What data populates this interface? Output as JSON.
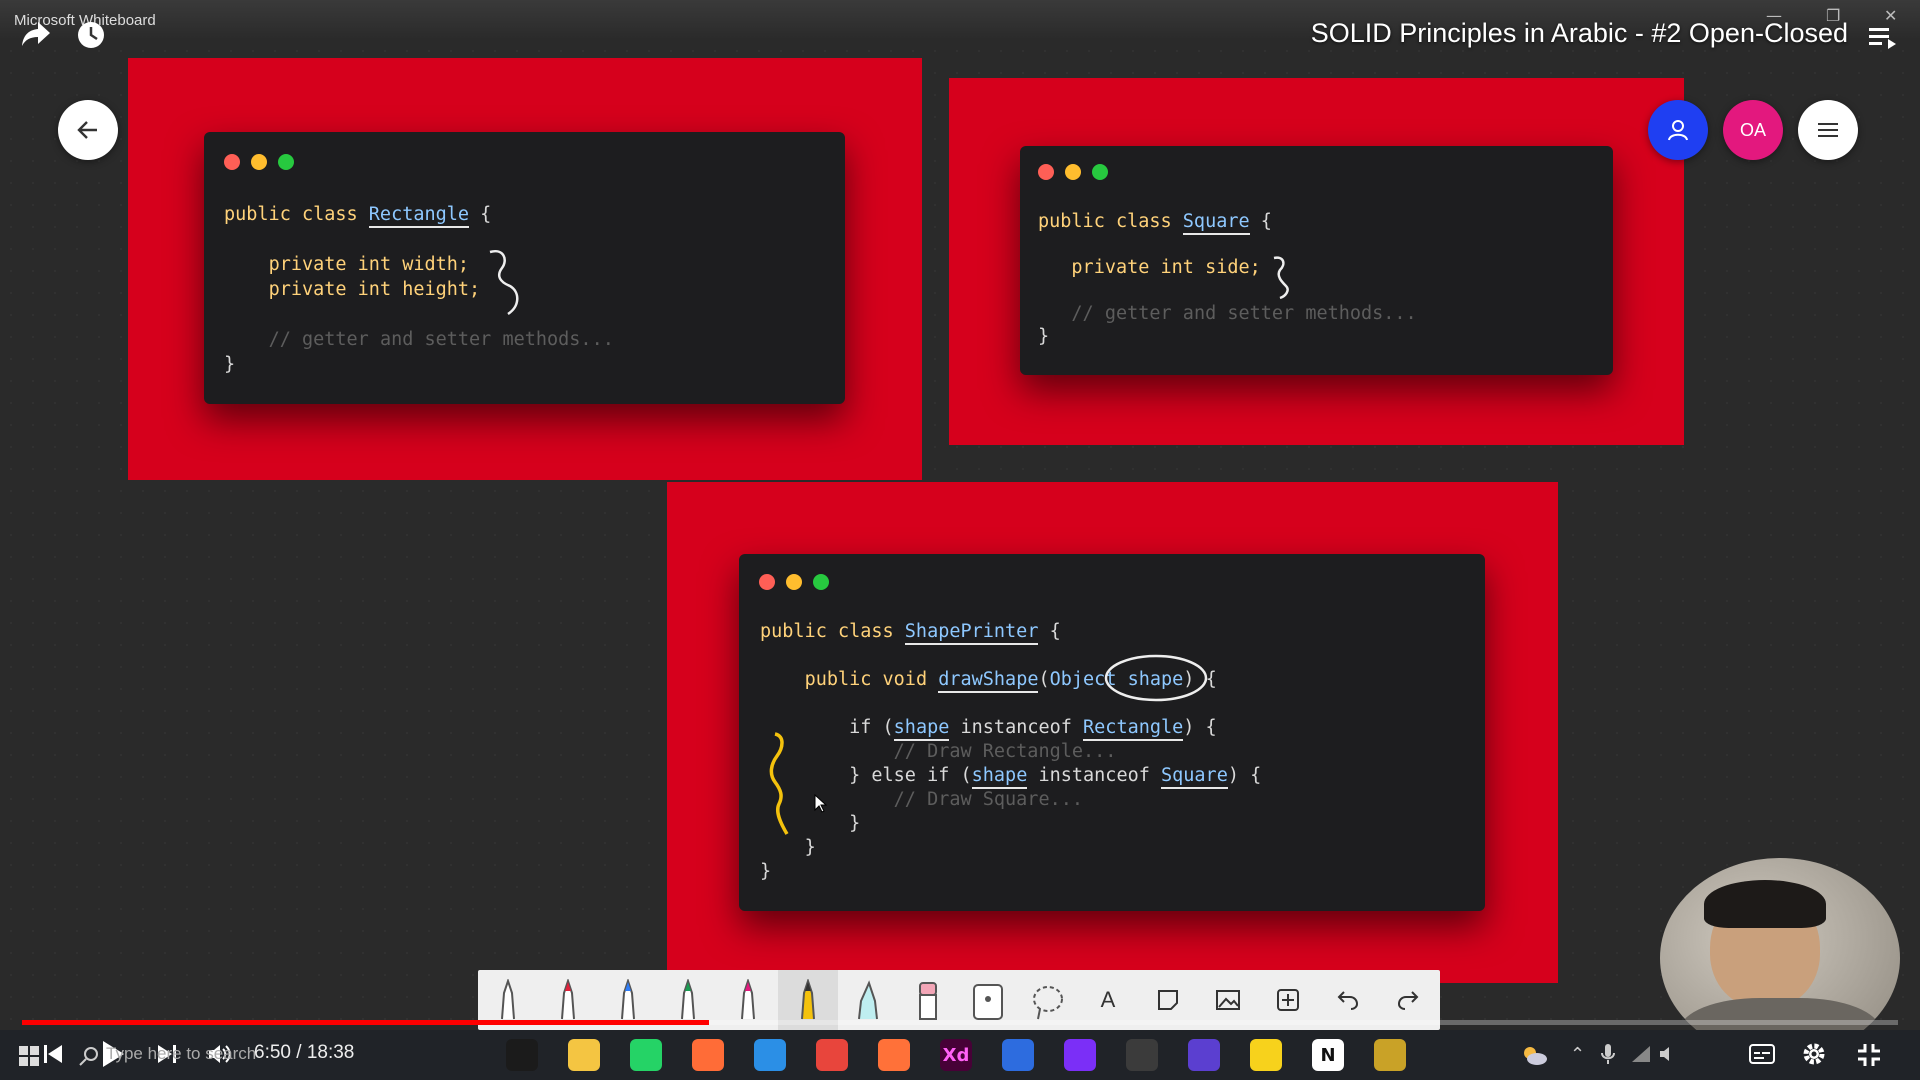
{
  "window": {
    "app_title": "Microsoft Whiteboard",
    "video_title": "SOLID Principles in Arabic - #2 Open-Closed"
  },
  "top_icons": [
    "share-icon",
    "watch-later-icon",
    "playlist-icon"
  ],
  "collaborators": {
    "invite": "person-icon",
    "user_initials": "OA",
    "menu": "hamburger-icon"
  },
  "colors": {
    "panel_red": "#d6001c",
    "card_bg": "#1d1d1f",
    "keyword": "#ffd27a",
    "type": "#8ec8ff",
    "dot_red": "#ff5f56",
    "dot_yellow": "#ffbd2e",
    "dot_green": "#27c93f",
    "invite_blue": "#1f3ff2",
    "avatar_pink": "#e3187e",
    "progress_red": "#ff0000"
  },
  "cards": {
    "rectangle": {
      "line1": {
        "kw": "public class",
        "name": "Rectangle",
        "brace": " {"
      },
      "line2": "private int width;",
      "line3": "private int height;",
      "comment": "// getter and setter methods...",
      "close": "}"
    },
    "square": {
      "line1": {
        "kw": "public class",
        "name": "Square",
        "brace": " {"
      },
      "line2": "private int side;",
      "comment": "// getter and setter methods...",
      "close": "}"
    },
    "printer": {
      "line1": {
        "kw": "public class",
        "name": "ShapePrinter",
        "brace": " {"
      },
      "line2": {
        "kw": "public void",
        "fn": "drawShape",
        "open": "(",
        "type": "Object",
        "param": "shape",
        "close": ") {"
      },
      "line3": {
        "pre": "if (",
        "var": "shape",
        "mid": " instanceof ",
        "type": "Rectangle",
        "post": ") {"
      },
      "comment1": "// Draw Rectangle...",
      "line4": {
        "pre": "} else if (",
        "var": "shape",
        "mid": " instanceof ",
        "type": "Square",
        "post": ") {"
      },
      "comment2": "// Draw Square...",
      "close1": "}",
      "close2": "}",
      "close3": "}"
    }
  },
  "toolbar": {
    "tools": [
      "pen-black-icon",
      "pen-red-icon",
      "pen-blue-icon",
      "pen-green-icon",
      "pen-pink-icon",
      "pen-yellow-icon",
      "highlighter-icon",
      "eraser-icon",
      "ruler-icon",
      "lasso-icon",
      "text-icon",
      "note-icon",
      "image-icon",
      "insert-icon",
      "undo-icon",
      "redo-icon"
    ],
    "text_tool_label": "A"
  },
  "player": {
    "current_time": "6:50",
    "separator": " / ",
    "duration": "18:38",
    "progress_fraction": 0.366
  },
  "taskbar": {
    "search_placeholder": "Type here to search",
    "apps": [
      {
        "name": "intellij-icon",
        "color": "#1b1b1b",
        "glyph": ""
      },
      {
        "name": "file-explorer-icon",
        "color": "#f4c542",
        "glyph": ""
      },
      {
        "name": "whatsapp-icon",
        "color": "#25d366",
        "glyph": ""
      },
      {
        "name": "postman-icon",
        "color": "#ff6c37",
        "glyph": ""
      },
      {
        "name": "vscode-icon",
        "color": "#2b8fe6",
        "glyph": ""
      },
      {
        "name": "chrome-icon",
        "color": "#e8453c",
        "glyph": ""
      },
      {
        "name": "firefox-icon",
        "color": "#ff7139",
        "glyph": ""
      },
      {
        "name": "xd-icon",
        "color": "#470137",
        "glyph": "Xd"
      },
      {
        "name": "whiteboard-icon",
        "color": "#2d6cdf",
        "glyph": ""
      },
      {
        "name": "podcast-icon",
        "color": "#7b2ff7",
        "glyph": ""
      },
      {
        "name": "obs-icon",
        "color": "#3b3b3b",
        "glyph": ""
      },
      {
        "name": "github-icon",
        "color": "#5b3fd0",
        "glyph": ""
      },
      {
        "name": "sticky-notes-icon",
        "color": "#f7d21c",
        "glyph": ""
      },
      {
        "name": "notion-icon",
        "color": "#ffffff",
        "glyph": "N"
      },
      {
        "name": "snip-icon",
        "color": "#c9a227",
        "glyph": ""
      }
    ]
  }
}
